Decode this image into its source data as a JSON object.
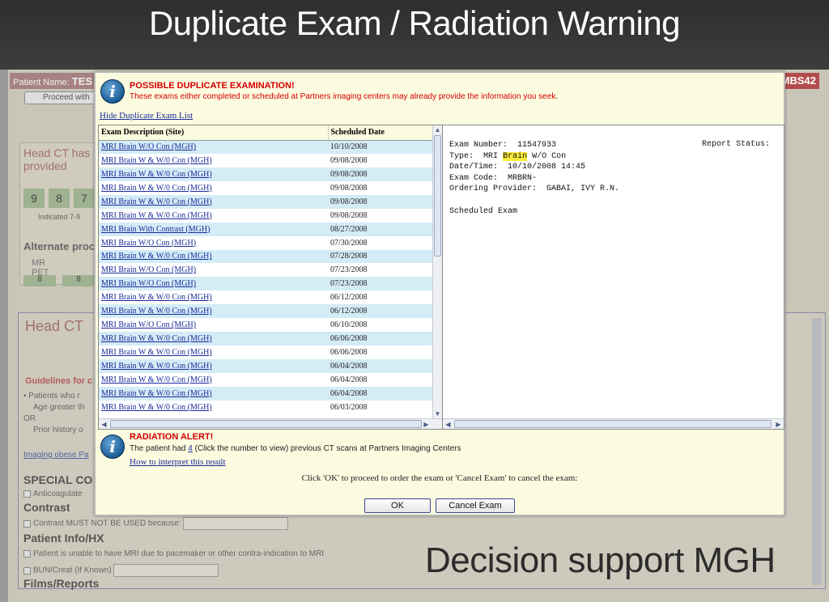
{
  "slide": {
    "title": "Duplicate Exam / Radiation Warning",
    "caption": "Decision support MGH"
  },
  "background": {
    "patient_label": "Patient Name:",
    "patient_name": "TES",
    "patient_id_fragment": "MBS42",
    "proceed_button": "Proceed with",
    "headct_box_title": "Head CT has provided",
    "scores": [
      "9",
      "8",
      "7"
    ],
    "indicated": "Indicated 7-9",
    "alternate_label": "Alternate proc",
    "alt_modalities": [
      "MR",
      "PET"
    ],
    "alt_scores": [
      "8",
      "8"
    ],
    "main_title": "Head CT",
    "guidelines": "Guidelines for c",
    "bullet_1": "Patients who r",
    "bullet_1b": "Age greater th",
    "or_label": "OR",
    "bullet_2": "Prior history o",
    "imaging_link": "Imaging obese Pa",
    "special_label": "SPECIAL CO",
    "anticoag": "Anticoagulate",
    "contrast_section": "Contrast",
    "contrast_option": "Contrast MUST NOT BE USED because:",
    "patient_info_section": "Patient Info/HX",
    "mri_option": "Patient is unable to have MRI due to pacemaker or other contra-indication to MRI",
    "bun_option": "BUN/Creat (If Known)",
    "films_section": "Films/Reports"
  },
  "dialog": {
    "duplicate_title": "POSSIBLE DUPLICATE EXAMINATION!",
    "duplicate_subtitle": "These exams either completed or scheduled at Partners imaging centers may already provide the information you seek.",
    "hide_link": "Hide Duplicate Exam List",
    "columns": {
      "description": "Exam Description (Site)",
      "date": "Scheduled Date"
    },
    "exams": [
      {
        "desc": "MRI Brain W/O Con (MGH)",
        "date": "10/10/2008"
      },
      {
        "desc": "MRI Brain W & W/0 Con (MGH)",
        "date": "09/08/2008"
      },
      {
        "desc": "MRI Brain W & W/0 Con (MGH)",
        "date": "09/08/2008"
      },
      {
        "desc": "MRI Brain W & W/0 Con (MGH)",
        "date": "09/08/2008"
      },
      {
        "desc": "MRI Brain W & W/0 Con (MGH)",
        "date": "09/08/2008"
      },
      {
        "desc": "MRI Brain W & W/0 Con (MGH)",
        "date": "09/08/2008"
      },
      {
        "desc": "MRI Brain With Contrast (MGH)",
        "date": "08/27/2008"
      },
      {
        "desc": "MRI Brain W/O Con (MGH)",
        "date": "07/30/2008"
      },
      {
        "desc": "MRI Brain W & W/0 Con (MGH)",
        "date": "07/28/2008"
      },
      {
        "desc": "MRI Brain W/O Con (MGH)",
        "date": "07/23/2008"
      },
      {
        "desc": "MRI Brain W/O Con (MGH)",
        "date": "07/23/2008"
      },
      {
        "desc": "MRI Brain W & W/0 Con (MGH)",
        "date": "06/12/2008"
      },
      {
        "desc": "MRI Brain W & W/0 Con (MGH)",
        "date": "06/12/2008"
      },
      {
        "desc": "MRI Brain W/O Con (MGH)",
        "date": "06/10/2008"
      },
      {
        "desc": "MRI Brain W & W/0 Con (MGH)",
        "date": "06/06/2008"
      },
      {
        "desc": "MRI Brain W & W/0 Con (MGH)",
        "date": "06/06/2008"
      },
      {
        "desc": "MRI Brain W & W/0 Con (MGH)",
        "date": "06/04/2008"
      },
      {
        "desc": "MRI Brain W & W/0 Con (MGH)",
        "date": "06/04/2008"
      },
      {
        "desc": "MRI Brain W & W/0 Con (MGH)",
        "date": "06/04/2008"
      },
      {
        "desc": "MRI Brain W & W/0 Con (MGH)",
        "date": "06/03/2008"
      }
    ],
    "report": {
      "exam_number_label": "Exam Number:",
      "exam_number": "11547933",
      "report_status_label": "Report Status:",
      "type_label": "Type:",
      "type_prefix": "MRI",
      "type_highlight": "Brain",
      "type_suffix": "W/O Con",
      "datetime_label": "Date/Time:",
      "datetime": "10/10/2008 14:45",
      "exam_code_label": "Exam Code:",
      "exam_code": "MRBRN-",
      "provider_label": "Ordering Provider:",
      "provider": "GABAI, IVY R.N.",
      "scheduled": "Scheduled Exam"
    },
    "radiation_title": "RADIATION ALERT!",
    "radiation_prefix": "The patient had",
    "radiation_count": "4",
    "radiation_suffix": "(Click the number to view) previous CT scans at Partners Imaging Centers",
    "interpret_link": "How to interpret this result",
    "proceed_text": "Click 'OK' to proceed to order the exam or 'Cancel Exam' to cancel the exam:",
    "ok_button": "OK",
    "cancel_button": "Cancel Exam"
  }
}
